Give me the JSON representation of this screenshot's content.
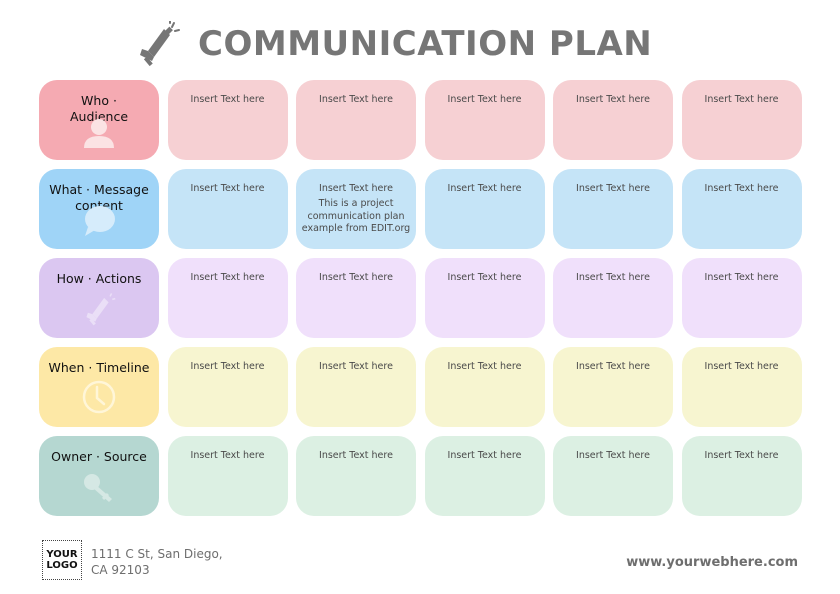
{
  "header": {
    "title": "COMMUNICATION PLAN",
    "icon": "megaphone-icon"
  },
  "colors": {
    "title": "#767676",
    "rows": [
      {
        "header": "#f5aab2",
        "cell": "#f6d0d3"
      },
      {
        "header": "#9fd4f7",
        "cell": "#c5e4f7"
      },
      {
        "header": "#dbc7f1",
        "cell": "#f0e0fb"
      },
      {
        "header": "#fde8a6",
        "cell": "#f7f5d0"
      },
      {
        "header": "#b5d7d1",
        "cell": "#dcf0e3"
      }
    ]
  },
  "rows": [
    {
      "label_line1": "Who ·",
      "label_line2": "Audience",
      "icon": "person-icon",
      "cells": [
        {
          "text": "Insert Text here"
        },
        {
          "text": "Insert Text here"
        },
        {
          "text": "Insert Text here"
        },
        {
          "text": "Insert Text here"
        },
        {
          "text": "Insert Text here"
        }
      ]
    },
    {
      "label_line1": "What · Message",
      "label_line2": "content",
      "icon": "speech-bubble-icon",
      "cells": [
        {
          "text": "Insert Text here"
        },
        {
          "text": "Insert Text here",
          "extra": "This is a project communication plan example from EDIT.org"
        },
        {
          "text": "Insert Text here"
        },
        {
          "text": "Insert Text here"
        },
        {
          "text": "Insert Text here"
        }
      ]
    },
    {
      "label_line1": "How · Actions",
      "label_line2": "",
      "icon": "megaphone-icon",
      "cells": [
        {
          "text": "Insert Text here"
        },
        {
          "text": "Insert Text here"
        },
        {
          "text": "Insert Text here"
        },
        {
          "text": "Insert Text here"
        },
        {
          "text": "Insert Text here"
        }
      ]
    },
    {
      "label_line1": "When · Timeline",
      "label_line2": "",
      "icon": "clock-icon",
      "cells": [
        {
          "text": "Insert Text here"
        },
        {
          "text": "Insert Text here"
        },
        {
          "text": "Insert Text here"
        },
        {
          "text": "Insert Text here"
        },
        {
          "text": "Insert Text here"
        }
      ]
    },
    {
      "label_line1": "Owner · Source",
      "label_line2": "",
      "icon": "key-icon",
      "cells": [
        {
          "text": "Insert Text here"
        },
        {
          "text": "Insert Text here"
        },
        {
          "text": "Insert Text here"
        },
        {
          "text": "Insert Text here"
        },
        {
          "text": "Insert Text here"
        }
      ]
    }
  ],
  "footer": {
    "logo_line1": "YOUR",
    "logo_line2": "LOGO",
    "address_line1": "1111 C St, San Diego,",
    "address_line2": "CA 92103",
    "website": "www.yourwebhere.com"
  }
}
